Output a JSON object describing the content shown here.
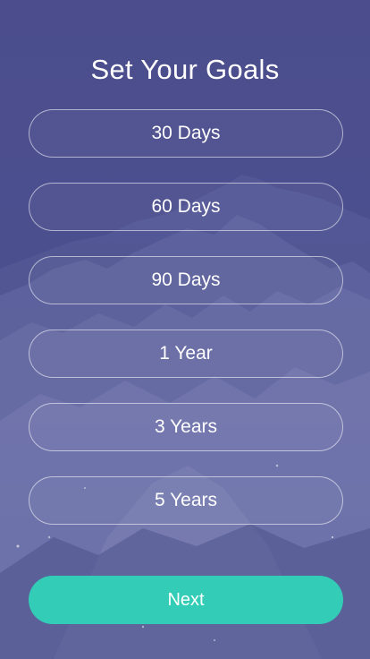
{
  "header": {
    "title": "Set Your Goals"
  },
  "goals": [
    {
      "label": "30 Days"
    },
    {
      "label": "60 Days"
    },
    {
      "label": "90 Days"
    },
    {
      "label": "1 Year"
    },
    {
      "label": "3 Years"
    },
    {
      "label": "5 Years"
    }
  ],
  "footer": {
    "next_label": "Next"
  },
  "colors": {
    "accent": "#33cdb7",
    "background": "#4b4d8c"
  }
}
